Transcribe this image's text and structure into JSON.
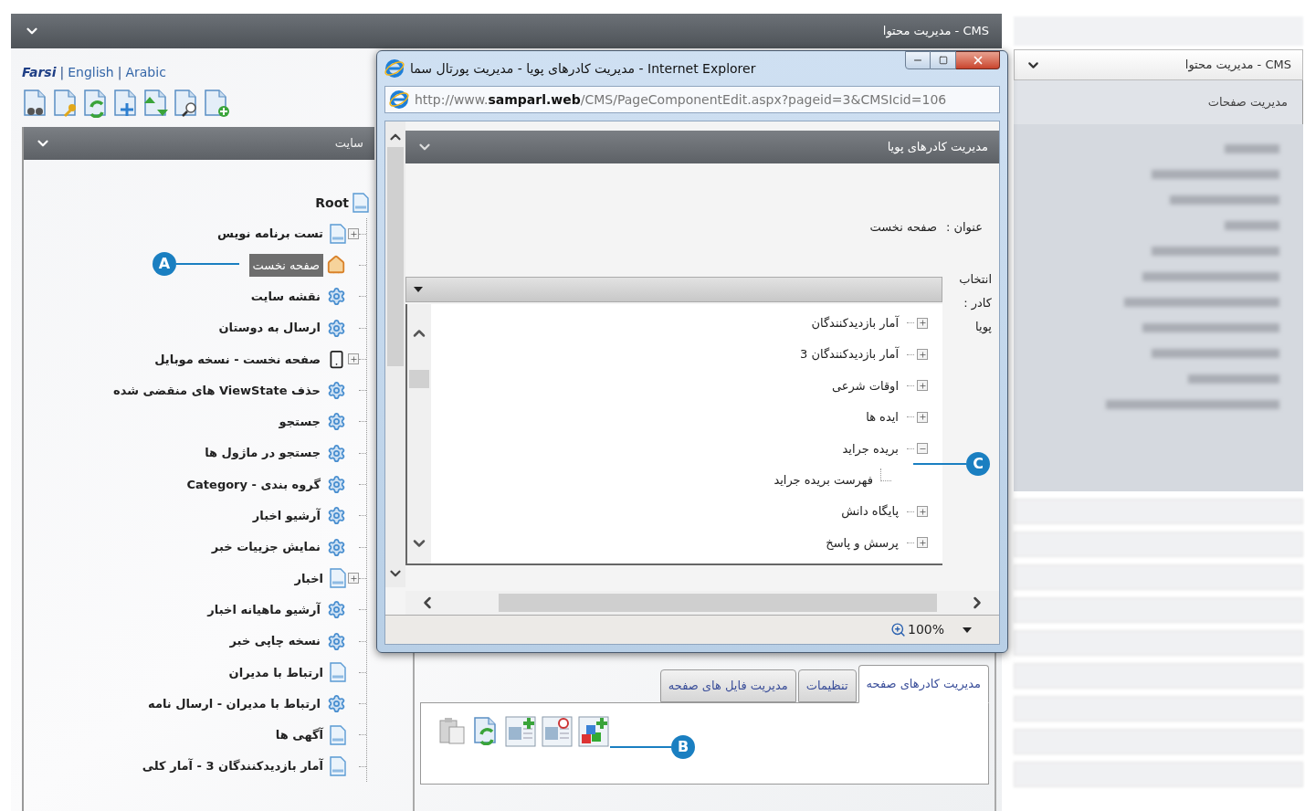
{
  "main_header": {
    "title": "مدیریت محتوا - CMS"
  },
  "languages": [
    {
      "label": "Arabic",
      "selected": false
    },
    {
      "label": "English",
      "selected": false
    },
    {
      "label": "Farsi",
      "selected": true
    }
  ],
  "language_separator": "|",
  "site_panel": {
    "title": "سایت",
    "root": {
      "label": "Root",
      "children": [
        {
          "label": "تست برنامه نویس",
          "kind": "page",
          "expandable": true,
          "selected": false
        },
        {
          "label": "صفحه نخست",
          "kind": "home",
          "expandable": false,
          "selected": true
        },
        {
          "label": "نقشه سایت",
          "kind": "gear",
          "expandable": false,
          "selected": false
        },
        {
          "label": "ارسال به دوستان",
          "kind": "gear",
          "expandable": false,
          "selected": false
        },
        {
          "label": "صفحه نخست - نسخه موبایل",
          "kind": "mobile",
          "expandable": true,
          "selected": false
        },
        {
          "label": "حذف ViewState های منقضی شده",
          "kind": "gear",
          "expandable": false,
          "selected": false
        },
        {
          "label": "جستجو",
          "kind": "gear",
          "expandable": false,
          "selected": false
        },
        {
          "label": "جستجو در ماژول ها",
          "kind": "gear",
          "expandable": false,
          "selected": false
        },
        {
          "label": "گروه بندی - Category",
          "kind": "gear",
          "expandable": false,
          "selected": false
        },
        {
          "label": "آرشیو اخبار",
          "kind": "gear",
          "expandable": false,
          "selected": false
        },
        {
          "label": "نمایش جزییات خبر",
          "kind": "gear",
          "expandable": false,
          "selected": false
        },
        {
          "label": "اخبار",
          "kind": "page",
          "expandable": true,
          "selected": false
        },
        {
          "label": "آرشیو ماهیانه اخبار",
          "kind": "gear",
          "expandable": false,
          "selected": false
        },
        {
          "label": "نسخه چاپی خبر",
          "kind": "gear",
          "expandable": false,
          "selected": false
        },
        {
          "label": "ارتباط با مدیران",
          "kind": "page",
          "expandable": false,
          "selected": false
        },
        {
          "label": "ارتباط با مدیران - ارسال نامه",
          "kind": "gear",
          "expandable": false,
          "selected": false
        },
        {
          "label": "آگهی ها",
          "kind": "page",
          "expandable": false,
          "selected": false
        },
        {
          "label": "آمار بازدیدکنندگان 3 - آمار کلی",
          "kind": "page",
          "expandable": false,
          "selected": false
        }
      ]
    }
  },
  "tabs": [
    {
      "label": "مدیریت کادرهای صفحه",
      "selected": true
    },
    {
      "label": "تنظیمات",
      "selected": false
    },
    {
      "label": "مدیریت فایل های صفحه",
      "selected": false
    }
  ],
  "popup": {
    "title": "مدیریت کادرهای پویا - مدیریت پورتال سما - Internet Explorer",
    "url": "http://www.**samparl.web**/CMS/PageComponentEdit.aspx?pageid=3&CMSIcid=106",
    "panel_title": "مدیریت کادرهای پویا",
    "title_label": "عنوان :",
    "title_value": "صفحه نخست",
    "select_label": "انتخاب کادر : پویا",
    "tree": [
      {
        "label": "آمار بازدیدکنندگان",
        "expanded": false
      },
      {
        "label": "آمار بازدیدکنندگان 3",
        "expanded": false
      },
      {
        "label": "اوقات شرعی",
        "expanded": false
      },
      {
        "label": "ایده ها",
        "expanded": false
      },
      {
        "label": "بریده جراید",
        "expanded": true,
        "children": [
          {
            "label": "فهرست بریده جراید"
          }
        ]
      },
      {
        "label": "پایگاه دانش",
        "expanded": false
      },
      {
        "label": "پرسش و پاسخ",
        "expanded": false
      }
    ],
    "zoom": "100%"
  },
  "right_sidebar": {
    "header": "مدیریت محتوا - CMS",
    "subitem": "مدیریت صفحات"
  },
  "annotations": [
    {
      "label": "A"
    },
    {
      "label": "B"
    },
    {
      "label": "C"
    }
  ]
}
